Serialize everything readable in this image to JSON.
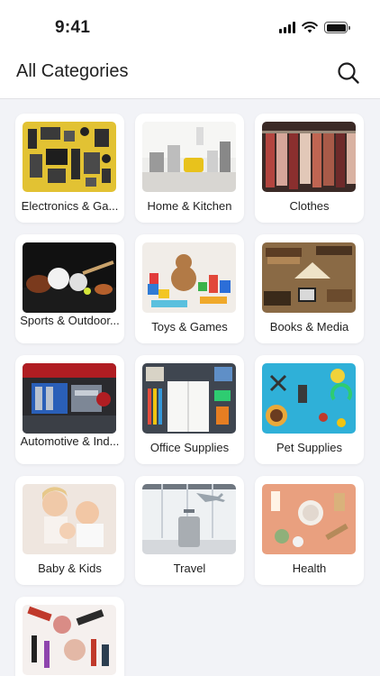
{
  "status": {
    "time": "9:41"
  },
  "header": {
    "title": "All Categories",
    "search_icon": "search-icon"
  },
  "categories": [
    {
      "label": "Electronics & Ga..."
    },
    {
      "label": "Home & Kitchen"
    },
    {
      "label": "Clothes"
    },
    {
      "label": "Sports & Outdoor..."
    },
    {
      "label": "Toys & Games"
    },
    {
      "label": "Books & Media"
    },
    {
      "label": "Automotive & Ind..."
    },
    {
      "label": "Office Supplies"
    },
    {
      "label": "Pet Supplies"
    },
    {
      "label": "Baby & Kids"
    },
    {
      "label": "Travel"
    },
    {
      "label": "Health"
    },
    {
      "label": ""
    }
  ]
}
